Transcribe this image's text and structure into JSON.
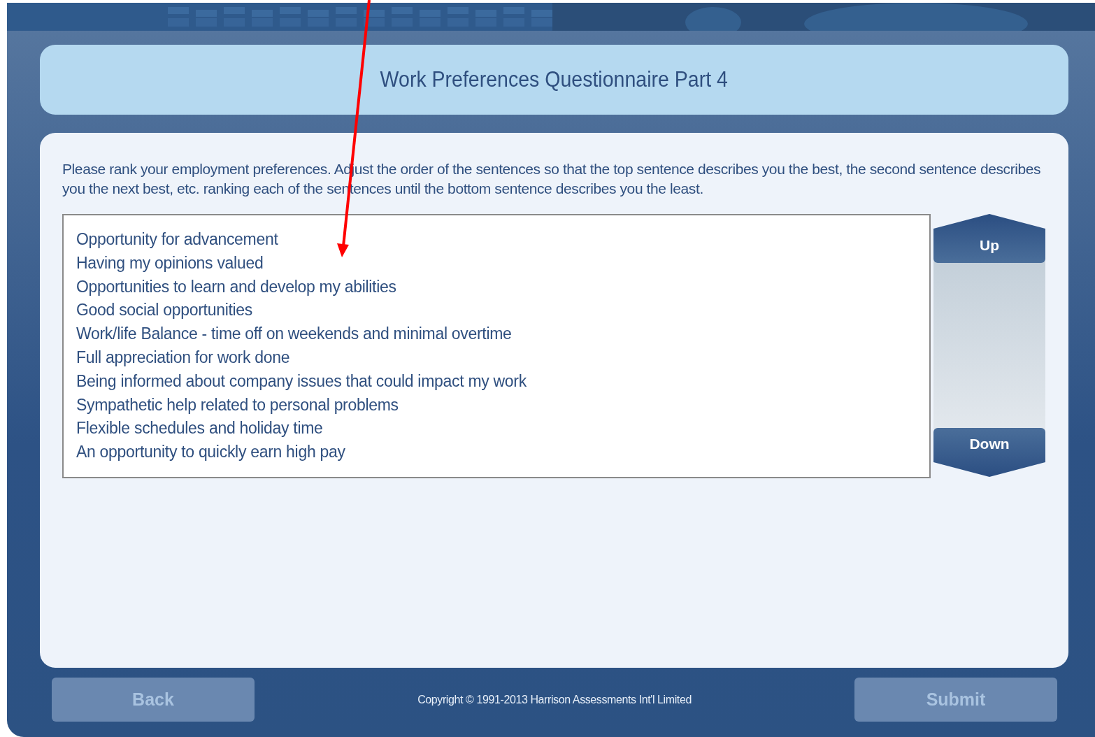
{
  "title": "Work Preferences Questionnaire Part 4",
  "instructions": "Please rank your employment preferences. Adjust the order of the sentences so that the top sentence describes you the best, the second sentence describes you the next best, etc. ranking each of the sentences until the bottom sentence describes you the least.",
  "ranking_list": [
    {
      "text": "Opportunity for advancement",
      "selected": false
    },
    {
      "text": "Having my opinions valued",
      "selected": false
    },
    {
      "text": "Opportunities to learn and develop my abilities",
      "selected": false
    },
    {
      "text": "Good social opportunities",
      "selected": false
    },
    {
      "text": "Work/life Balance - time off on weekends and minimal overtime",
      "selected": false
    },
    {
      "text": "Full appreciation for work done",
      "selected": false
    },
    {
      "text": "Being informed about company issues that could impact my work",
      "selected": false
    },
    {
      "text": "Sympathetic help related to personal problems",
      "selected": false
    },
    {
      "text": "Flexible schedules and holiday time",
      "selected": false
    },
    {
      "text": "An opportunity to quickly earn high pay",
      "selected": false
    }
  ],
  "move_buttons": {
    "up": "Up",
    "down": "Down"
  },
  "footer": {
    "back": {
      "label": "Back",
      "disabled": true
    },
    "copyright": "Copyright © 1991-2013 Harrison Assessments Int'l Limited",
    "submit": {
      "label": "Submit",
      "disabled": true
    }
  },
  "annotation": {
    "kind": "arrow",
    "color": "#ff0000"
  }
}
